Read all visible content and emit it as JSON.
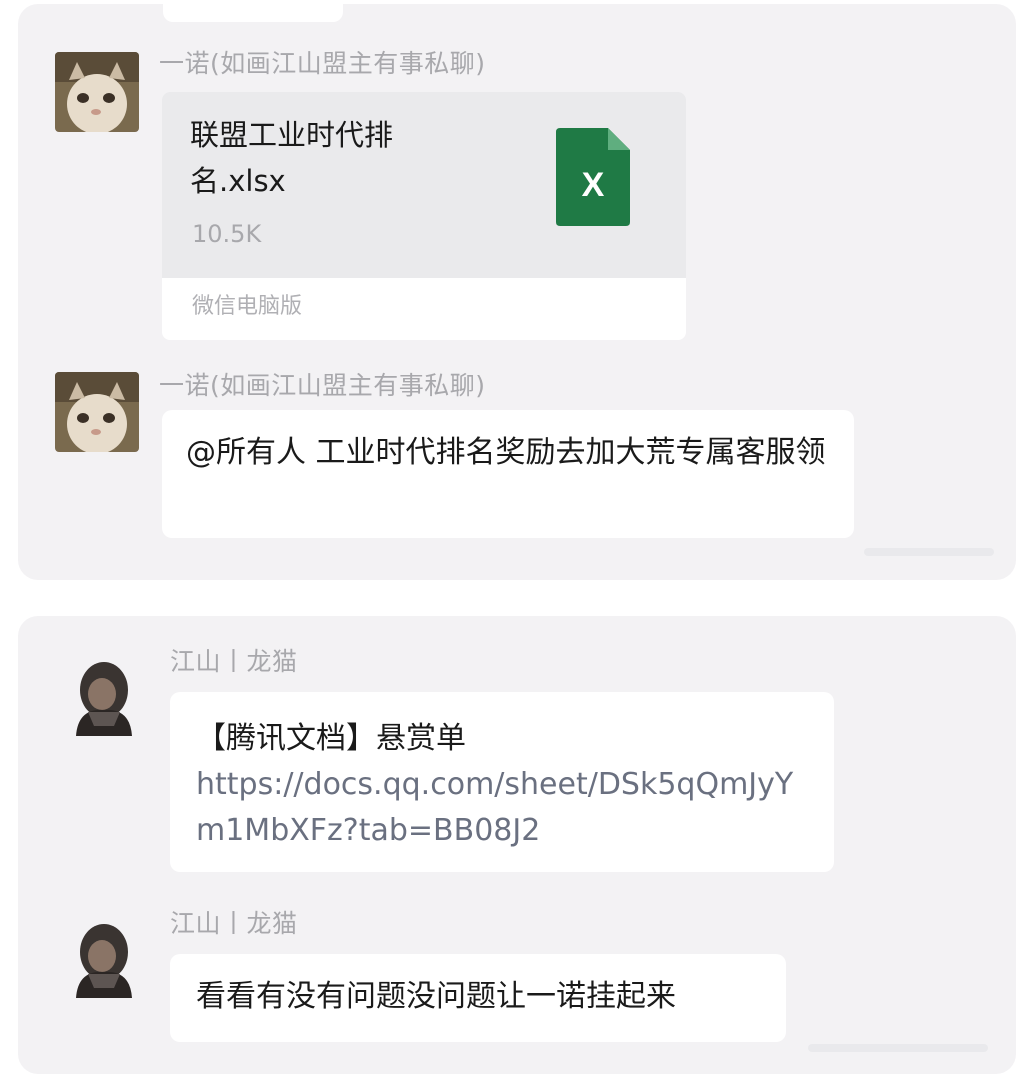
{
  "colors": {
    "panel_bg": "#f3f2f4",
    "bubble_bg": "#ffffff",
    "sender_text": "#a8a8ac",
    "excel_green": "#1f7a45",
    "link_text": "#6a7080"
  },
  "panel_top": {
    "messages": [
      {
        "sender": "一诺(如画江山盟主有事私聊)",
        "avatar_icon": "cat-avatar-icon",
        "type": "file",
        "file": {
          "name": "联盟工业时代排名.xlsx",
          "size": "10.5K",
          "source": "微信电脑版",
          "icon": "excel-file-icon",
          "icon_letter": "X"
        }
      },
      {
        "sender": "一诺(如画江山盟主有事私聊)",
        "avatar_icon": "cat-avatar-icon",
        "type": "text",
        "text": "@所有人 工业时代排名奖励去加大荒专属客服领"
      }
    ]
  },
  "panel_bottom": {
    "messages": [
      {
        "sender": "江山丨龙猫",
        "avatar_icon": "dark-character-avatar-icon",
        "type": "text",
        "text_line1": "【腾讯文档】悬赏单",
        "link": "https://docs.qq.com/sheet/DSk5qQmJyYm1MbXFz?tab=BB08J2"
      },
      {
        "sender": "江山丨龙猫",
        "avatar_icon": "dark-character-avatar-icon",
        "type": "text",
        "text": "看看有没有问题没问题让一诺挂起来"
      }
    ]
  }
}
